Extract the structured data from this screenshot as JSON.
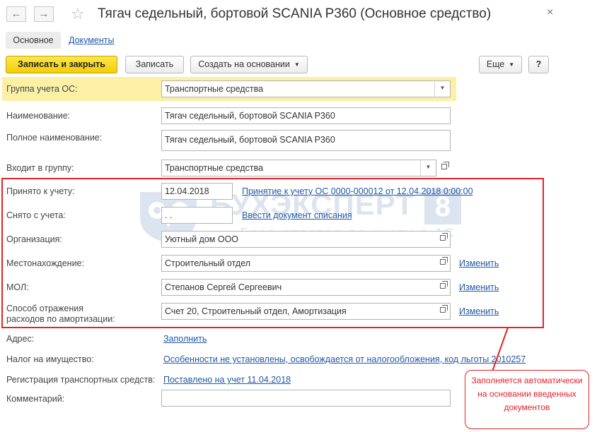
{
  "window": {
    "back_glyph": "←",
    "forward_glyph": "→",
    "star_glyph": "☆",
    "title": "Тягач седельный, бортовой SCANIA P360 (Основное средство)",
    "close_glyph": "×"
  },
  "tabs": [
    {
      "label": "Основное"
    },
    {
      "label": "Документы"
    }
  ],
  "toolbar": {
    "save_close": "Записать и закрыть",
    "save": "Записать",
    "create_based": "Создать на основании",
    "more": "Еще",
    "help": "?"
  },
  "form": {
    "group_label": "Группа учета ОС:",
    "group_value": "Транспортные средства",
    "name_label": "Наименование:",
    "name_value": "Тягач седельный, бортовой SCANIA P360",
    "fullname_label": "Полное наименование:",
    "fullname_value": "Тягач седельный, бортовой SCANIA P360",
    "parent_label": "Входит в группу:",
    "parent_value": "Транспортные средства",
    "accepted_label": "Принято к учету:",
    "accepted_date": "12.04.2018",
    "accepted_doc_link": "Принятие к учету ОС 0000-000012 от 12.04.2018 0:00:00",
    "removed_label": "Снято с учета:",
    "removed_date": " .  .",
    "removed_link": "Ввести документ списания",
    "org_label": "Организация:",
    "org_value": "Уютный дом ООО",
    "location_label": "Местонахождение:",
    "location_value": "Строительный отдел",
    "mol_label": "МОЛ:",
    "mol_value": "Степанов Сергей Сергеевич",
    "deprec_label_1": "Способ отражения",
    "deprec_label_2": "расходов по амортизации:",
    "deprec_value": "Счет 20, Строительный отдел, Амортизация",
    "change_link": "Изменить",
    "address_label": "Адрес:",
    "address_link": "Заполнить",
    "tax_label": "Налог на имущество:",
    "tax_link": "Особенности не установлены, освобождается от налогообложения, код льготы 2010257",
    "vehicle_reg_label": "Регистрация транспортных средств:",
    "vehicle_reg_link": "Поставлено на учет 11.04.2018",
    "comment_label": "Комментарий:",
    "comment_value": ""
  },
  "watermark": {
    "brand": "БУХЭКСПЕРТ",
    "number": "8",
    "tagline": "База ответов по учету в 1С"
  },
  "annotation": {
    "line1": "Заполняется автоматически",
    "line2": "на основании введенных",
    "line3": "документов",
    "color": "#e1232b"
  },
  "colors": {
    "primary_button": "#f2cd0a",
    "highlight_row": "#fbf0a6",
    "link": "#2158a8"
  }
}
